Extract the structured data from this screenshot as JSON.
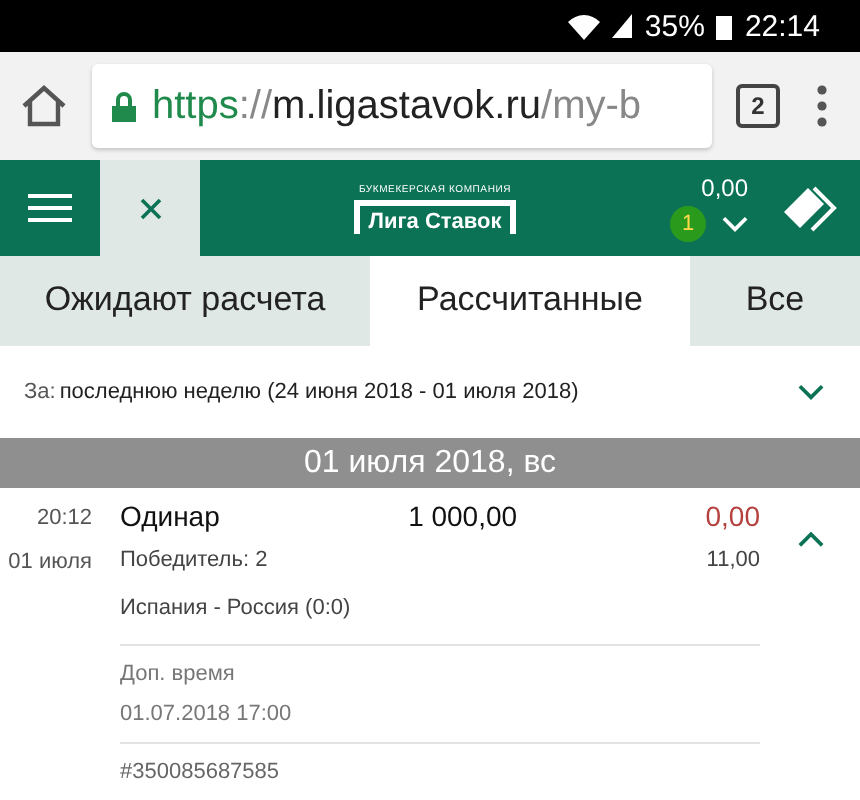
{
  "status_bar": {
    "battery": "35%",
    "time": "22:14"
  },
  "browser": {
    "url": {
      "scheme": "https",
      "separator": "://",
      "host": "m.ligastavok.ru",
      "path": "/my-b"
    },
    "tab_count": "2"
  },
  "header": {
    "logo_caption": "БУКМЕКЕРСКАЯ КОМПАНИЯ",
    "logo_name": "Лига Ставок",
    "balance": "0,00",
    "bet_count": "1"
  },
  "tabs": [
    {
      "label": "Ожидают расчета",
      "selected": false
    },
    {
      "label": "Рассчитанные",
      "selected": true
    },
    {
      "label": "Все",
      "selected": false
    }
  ],
  "period": {
    "label": "За:",
    "value": "последнюю неделю (24 июня 2018 - 01 июля 2018)"
  },
  "day_header": "01 июля 2018, вс",
  "bet": {
    "time": "20:12",
    "date": "01 июля",
    "type": "Одинар",
    "stake": "1 000,00",
    "payout": "0,00",
    "market": "Победитель: 2",
    "odds": "11,00",
    "event": "Испания - Россия  (0:0)",
    "extra_label": "Доп. время",
    "extra_date": "01.07.2018 17:00",
    "number": "#350085687585",
    "expanded": true
  }
}
